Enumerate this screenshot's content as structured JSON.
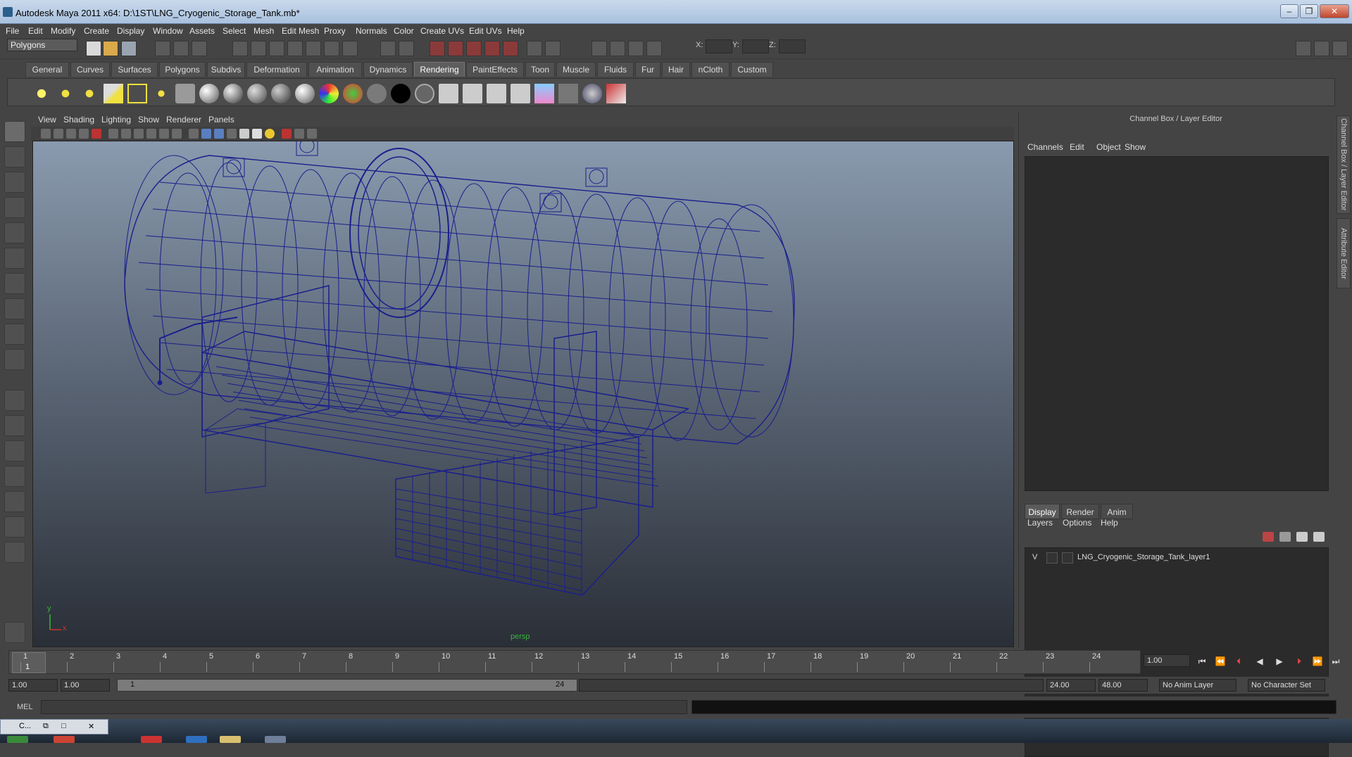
{
  "window": {
    "title": "Autodesk Maya 2011 x64: D:\\1ST\\LNG_Cryogenic_Storage_Tank.mb*",
    "min": "–",
    "max": "❐",
    "close": "✕"
  },
  "menu": [
    "File",
    "Edit",
    "Modify",
    "Create",
    "Display",
    "Window",
    "Assets",
    "Select",
    "Mesh",
    "Edit Mesh",
    "Proxy",
    "Normals",
    "Color",
    "Create UVs",
    "Edit UVs",
    "Help"
  ],
  "status": {
    "mode": "Polygons",
    "x_label": "X:",
    "y_label": "Y:",
    "z_label": "Z:"
  },
  "shelf_tabs": [
    "General",
    "Curves",
    "Surfaces",
    "Polygons",
    "Subdivs",
    "Deformation",
    "Animation",
    "Dynamics",
    "Rendering",
    "PaintEffects",
    "Toon",
    "Muscle",
    "Fluids",
    "Fur",
    "Hair",
    "nCloth",
    "Custom"
  ],
  "shelf_active": "Rendering",
  "panel_menu": [
    "View",
    "Shading",
    "Lighting",
    "Show",
    "Renderer",
    "Panels"
  ],
  "viewport": {
    "camera": "persp",
    "axis_x": "x",
    "axis_y": "y",
    "wire_color": "#1a1f8c"
  },
  "channel_box": {
    "title": "Channel Box / Layer Editor",
    "menu": [
      "Channels",
      "Edit",
      "Object",
      "Show"
    ]
  },
  "layer_editor": {
    "tabs": [
      "Display",
      "Render",
      "Anim"
    ],
    "active": "Display",
    "menu": [
      "Layers",
      "Options",
      "Help"
    ],
    "layer": {
      "visible": "V",
      "name": "LNG_Cryogenic_Storage_Tank_layer1"
    }
  },
  "side_tabs": [
    "Channel Box / Layer Editor",
    "Attribute Editor"
  ],
  "timeline": {
    "ticks": [
      "1",
      "2",
      "3",
      "4",
      "5",
      "6",
      "7",
      "8",
      "9",
      "10",
      "11",
      "12",
      "13",
      "14",
      "15",
      "16",
      "17",
      "18",
      "19",
      "20",
      "21",
      "22",
      "23",
      "24"
    ],
    "current": "1",
    "current_time": "1.00"
  },
  "range": {
    "start": "1.00",
    "anim_start": "1.00",
    "slider_start": "1",
    "slider_end": "24",
    "end": "24.00",
    "anim_end": "48.00",
    "anim_layer": "No Anim Layer",
    "char_set": "No Character Set"
  },
  "cmd": {
    "label": "MEL"
  },
  "taskbar": {
    "min_title": "C..."
  }
}
